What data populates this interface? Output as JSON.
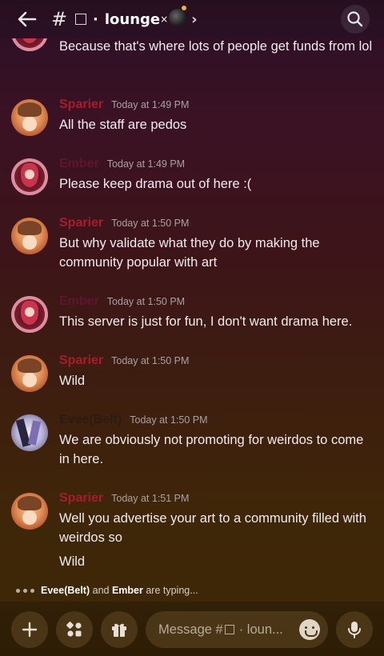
{
  "header": {
    "hash": "#",
    "channel_name": "lounge",
    "separator": "·",
    "close_glyph": "×",
    "chevron": "›"
  },
  "colors": {
    "sparier": "#a51e2b",
    "ember": "#5e1530",
    "evee": "#2b1b10"
  },
  "messages": [
    {
      "author": "",
      "time": "",
      "lines": "Because that's where lots of people get funds from lol",
      "avatar": "ember"
    },
    {
      "author": "Sparier",
      "time": "Today at 1:49 PM",
      "lines": "All the staff are pedos",
      "avatar": "sparier"
    },
    {
      "author": "Ember",
      "time": "Today at 1:49 PM",
      "lines": "Please keep drama out of here :(",
      "avatar": "ember"
    },
    {
      "author": "Sparier",
      "time": "Today at 1:50 PM",
      "lines": "But why validate what they do by making the community popular with art",
      "avatar": "sparier"
    },
    {
      "author": "Ember",
      "time": "Today at 1:50 PM",
      "lines": "This server is just for fun, I don't want drama here.",
      "avatar": "ember"
    },
    {
      "author": "Sparier",
      "time": "Today at 1:50 PM",
      "lines": "Wild",
      "avatar": "sparier"
    },
    {
      "author": "Evee(Belt)",
      "time": "Today at 1:50 PM",
      "lines": "We are obviously not promoting for weirdos to come in here.",
      "avatar": "evee"
    },
    {
      "author": "Sparier",
      "time": "Today at 1:51 PM",
      "lines": "Well you advertise your art to a community filled with weirdos so",
      "extra": "Wild",
      "avatar": "sparier"
    }
  ],
  "typing": {
    "user1": "Evee(Belt)",
    "and": " and ",
    "user2": "Ember",
    "suffix": " are typing..."
  },
  "composer": {
    "placeholder": "Message #",
    "placeholder_rest": "· loun..."
  }
}
